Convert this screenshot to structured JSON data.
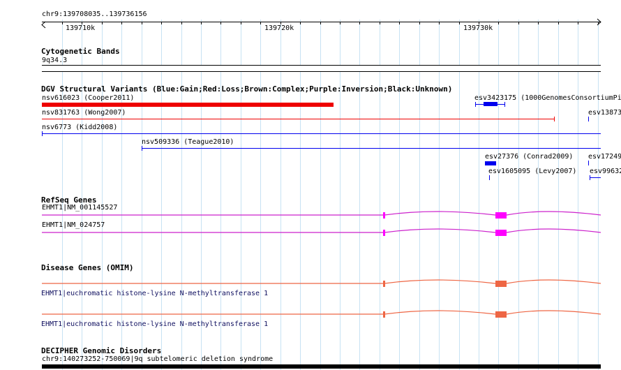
{
  "ruler": {
    "locus": "chr9:139708035..139736156",
    "ticks": [
      "139710k",
      "139720k",
      "139730k"
    ]
  },
  "tracks": {
    "cytobands": {
      "title": "Cytogenetic Bands",
      "band": "9q34.3"
    },
    "dgv": {
      "title": "DGV Structural Variants (Blue:Gain;Red:Loss;Brown:Complex;Purple:Inversion;Black:Unknown)",
      "items": [
        "nsv616023 (Cooper2011)",
        "esv3423175 (1000GenomesConsortiumPi",
        "nsv831763 (Wong2007)",
        "esv13873",
        "nsv6773 (Kidd2008)",
        "nsv509336 (Teague2010)",
        "esv27376 (Conrad2009)",
        "esv17249",
        "esv1605095 (Levy2007)",
        "esv99632"
      ],
      "colors": {
        "gain": "#0000ee",
        "loss": "#ee0000"
      }
    },
    "refseq": {
      "title": "RefSeq Genes",
      "items": [
        "EHMT1|NM_001145527",
        "EHMT1|NM_024757"
      ],
      "color": "#cc22cc",
      "exon_color": "#ff00ff"
    },
    "omim": {
      "title": "Disease Genes (OMIM)",
      "items": [
        "EHMT1|euchromatic histone-lysine N-methyltransferase 1",
        "EHMT1|euchromatic histone-lysine N-methyltransferase 1"
      ],
      "color": "#ee6644"
    },
    "decipher": {
      "title": "DECIPHER Genomic Disorders",
      "item": "chr9:140273252-750069|9q subtelomeric deletion syndrome"
    }
  }
}
